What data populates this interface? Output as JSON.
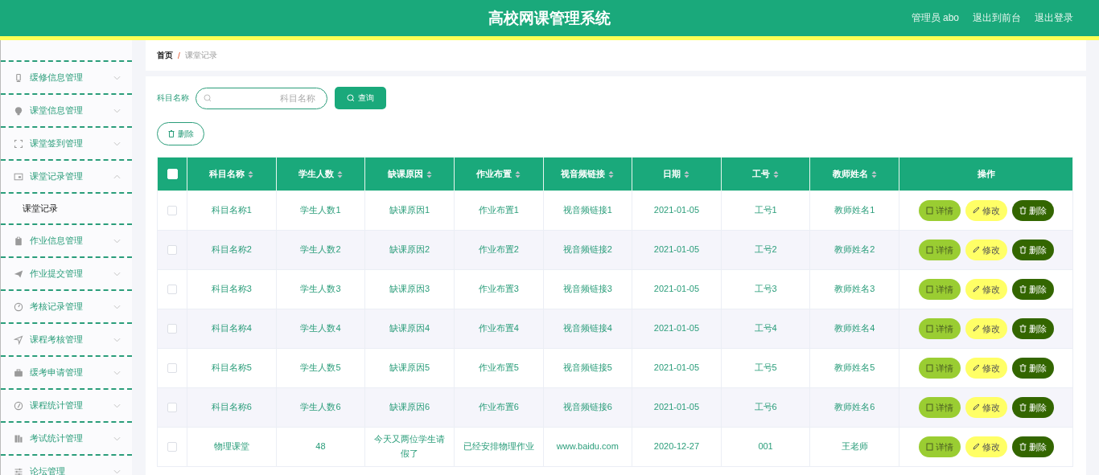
{
  "header": {
    "title": "高校网课管理系统",
    "links": [
      "管理员 abo",
      "退出到前台",
      "退出登录"
    ]
  },
  "sidebar": {
    "items": [
      {
        "label": "缓修信息管理",
        "expanded": false
      },
      {
        "label": "课堂信息管理",
        "expanded": false
      },
      {
        "label": "课堂签到管理",
        "expanded": false
      },
      {
        "label": "课堂记录管理",
        "expanded": true,
        "children": [
          {
            "label": "课堂记录"
          }
        ]
      },
      {
        "label": "作业信息管理",
        "expanded": false
      },
      {
        "label": "作业提交管理",
        "expanded": false
      },
      {
        "label": "考核记录管理",
        "expanded": false
      },
      {
        "label": "课程考核管理",
        "expanded": false
      },
      {
        "label": "缓考申请管理",
        "expanded": false
      },
      {
        "label": "课程统计管理",
        "expanded": false
      },
      {
        "label": "考试统计管理",
        "expanded": false
      },
      {
        "label": "论坛管理",
        "expanded": false
      }
    ]
  },
  "breadcrumb": {
    "home": "首页",
    "separator": "/",
    "current": "课堂记录"
  },
  "search": {
    "label": "科目名称",
    "placeholder": "科目名称",
    "button": "查询"
  },
  "delete_button": "删除",
  "table": {
    "select_all": {
      "checked": false
    },
    "columns": [
      {
        "label": "科目名称",
        "sortable": true
      },
      {
        "label": "学生人数",
        "sortable": true
      },
      {
        "label": "缺课原因",
        "sortable": true
      },
      {
        "label": "作业布置",
        "sortable": true
      },
      {
        "label": "视音频链接",
        "sortable": true
      },
      {
        "label": "日期",
        "sortable": true
      },
      {
        "label": "工号",
        "sortable": true
      },
      {
        "label": "教师姓名",
        "sortable": true
      },
      {
        "label": "操作",
        "sortable": false
      }
    ],
    "rows": [
      {
        "checked": false,
        "cells": [
          "科目名称1",
          "学生人数1",
          "缺课原因1",
          "作业布置1",
          "视音频链接1",
          "2021-01-05",
          "工号1",
          "教师姓名1"
        ],
        "actions": [
          {
            "kind": "detail",
            "label": "详情"
          },
          {
            "kind": "edit",
            "label": "修改"
          },
          {
            "kind": "delete",
            "label": "删除"
          }
        ]
      },
      {
        "checked": false,
        "cells": [
          "科目名称2",
          "学生人数2",
          "缺课原因2",
          "作业布置2",
          "视音频链接2",
          "2021-01-05",
          "工号2",
          "教师姓名2"
        ],
        "actions": [
          {
            "kind": "detail",
            "label": "详情"
          },
          {
            "kind": "edit",
            "label": "修改"
          },
          {
            "kind": "delete",
            "label": "删除"
          }
        ]
      },
      {
        "checked": false,
        "cells": [
          "科目名称3",
          "学生人数3",
          "缺课原因3",
          "作业布置3",
          "视音频链接3",
          "2021-01-05",
          "工号3",
          "教师姓名3"
        ],
        "actions": [
          {
            "kind": "detail",
            "label": "详情"
          },
          {
            "kind": "edit",
            "label": "修改"
          },
          {
            "kind": "delete",
            "label": "删除"
          }
        ]
      },
      {
        "checked": false,
        "cells": [
          "科目名称4",
          "学生人数4",
          "缺课原因4",
          "作业布置4",
          "视音频链接4",
          "2021-01-05",
          "工号4",
          "教师姓名4"
        ],
        "actions": [
          {
            "kind": "detail",
            "label": "详情"
          },
          {
            "kind": "edit",
            "label": "修改"
          },
          {
            "kind": "delete",
            "label": "删除"
          }
        ]
      },
      {
        "checked": false,
        "cells": [
          "科目名称5",
          "学生人数5",
          "缺课原因5",
          "作业布置5",
          "视音频链接5",
          "2021-01-05",
          "工号5",
          "教师姓名5"
        ],
        "actions": [
          {
            "kind": "detail",
            "label": "详情"
          },
          {
            "kind": "edit",
            "label": "修改"
          },
          {
            "kind": "delete",
            "label": "删除"
          }
        ]
      },
      {
        "checked": false,
        "cells": [
          "科目名称6",
          "学生人数6",
          "缺课原因6",
          "作业布置6",
          "视音频链接6",
          "2021-01-05",
          "工号6",
          "教师姓名6"
        ],
        "actions": [
          {
            "kind": "detail",
            "label": "详情"
          },
          {
            "kind": "edit",
            "label": "修改"
          },
          {
            "kind": "delete",
            "label": "删除"
          }
        ]
      },
      {
        "checked": false,
        "cells": [
          "物理课堂",
          "48",
          "今天又两位学生请假了",
          "已经安排物理作业",
          "www.baidu.com",
          "2020-12-27",
          "001",
          "王老师"
        ],
        "actions": [
          {
            "kind": "detail",
            "label": "详情"
          },
          {
            "kind": "edit",
            "label": "修改"
          },
          {
            "kind": "delete",
            "label": "删除"
          }
        ]
      }
    ]
  }
}
